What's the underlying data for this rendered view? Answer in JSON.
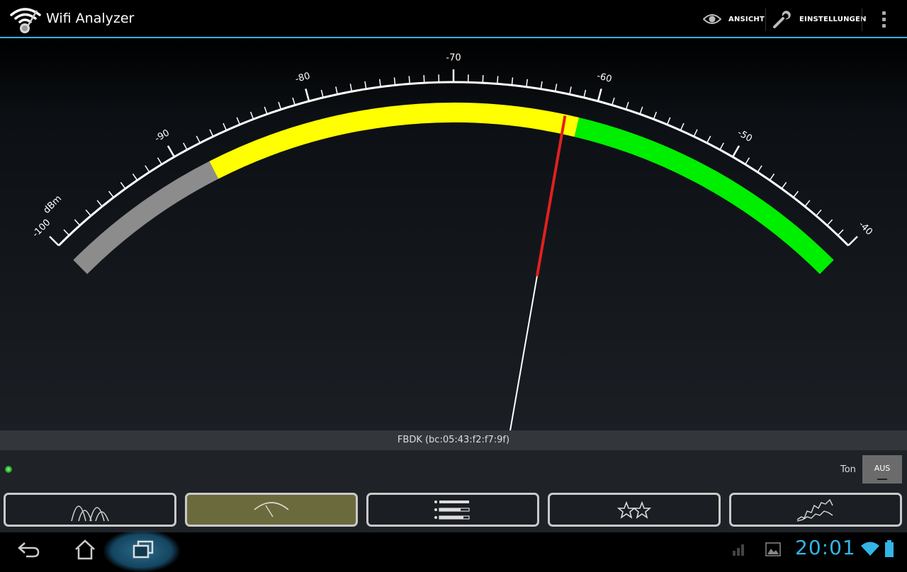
{
  "app": {
    "title": "Wifi Analyzer"
  },
  "actionbar": {
    "view_label": "ANSICHT",
    "settings_label": "EINSTELLUNGEN",
    "view_icon": "eye-icon",
    "settings_icon": "wrench-icon",
    "overflow_icon": "overflow-menu-icon"
  },
  "meter": {
    "unit": "dBm",
    "min": -100,
    "max": -40,
    "labels": [
      "-100",
      "-90",
      "-80",
      "-70",
      "-60",
      "-50",
      "-40"
    ],
    "bands": [
      {
        "from": -100,
        "to": -88,
        "color": "#8c8c8c"
      },
      {
        "from": -88,
        "to": -61,
        "color": "#ffff00"
      },
      {
        "from": -61,
        "to": -40,
        "color": "#00ee00"
      }
    ],
    "needle_value": -62,
    "needle_color": "#e02020"
  },
  "network": {
    "label": "FBDK (bc:05:43:f2:f7:9f)"
  },
  "sound": {
    "label": "Ton",
    "state": "AUS"
  },
  "tabs": [
    {
      "icon": "channel-graph-icon",
      "active": false
    },
    {
      "icon": "signal-meter-icon",
      "active": true
    },
    {
      "icon": "ap-list-icon",
      "active": false
    },
    {
      "icon": "channel-rating-icon",
      "active": false
    },
    {
      "icon": "time-graph-icon",
      "active": false
    }
  ],
  "systembar": {
    "time": "20:01",
    "accent_color": "#33b5e5",
    "icons": [
      "back-icon",
      "home-icon",
      "recents-icon",
      "signal-bars-icon",
      "gallery-icon",
      "wifi-icon",
      "battery-icon"
    ]
  }
}
